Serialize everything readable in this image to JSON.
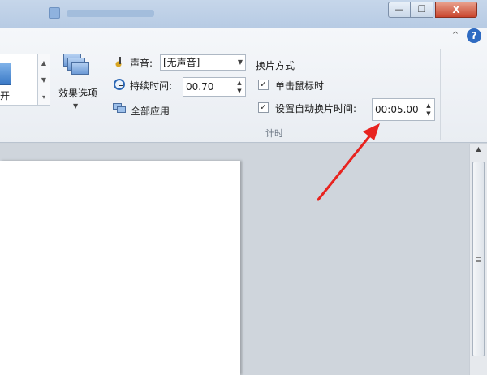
{
  "window": {
    "minimize": "—",
    "maximize": "❐",
    "close": "X"
  },
  "ribbon": {
    "help": "?",
    "collapse": "^",
    "gallery_partial_label": "开",
    "effect_options": "效果选项",
    "sound": {
      "label": "声音:",
      "value": "[无声音]"
    },
    "duration": {
      "label": "持续时间:",
      "value": "00.70"
    },
    "apply_all": "全部应用",
    "advance": {
      "heading": "换片方式",
      "on_click": {
        "label": "单击鼠标时",
        "checked": true
      },
      "after": {
        "label": "设置自动换片时间:",
        "checked": true,
        "value": "00:05.00"
      }
    },
    "group_label": "计时"
  },
  "annotation": {
    "color": "#e8231f"
  }
}
